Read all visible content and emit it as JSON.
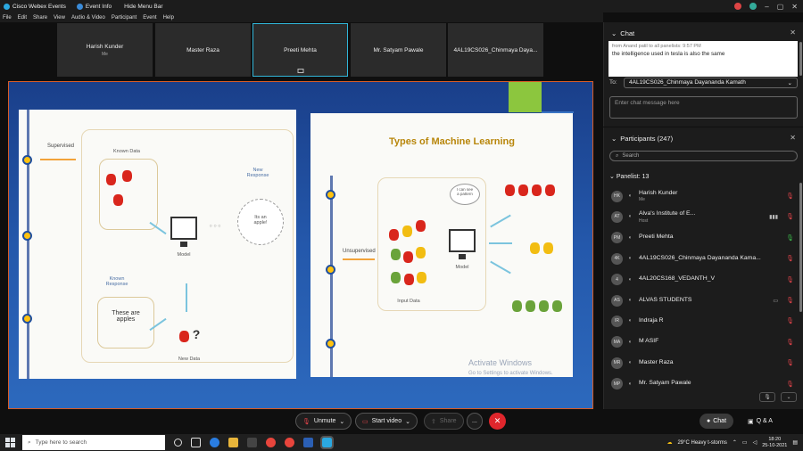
{
  "title_bar": {
    "app_name": "Cisco Webex Events",
    "event_info": "Event Info",
    "hide_menu": "Hide Menu Bar"
  },
  "menu": [
    "File",
    "Edit",
    "Share",
    "View",
    "Audio & Video",
    "Participant",
    "Event",
    "Help"
  ],
  "video_tiles": [
    {
      "name": "Harish Kunder",
      "sub": "Me"
    },
    {
      "name": "Master Raza"
    },
    {
      "name": "Preeti Mehta",
      "active": true
    },
    {
      "name": "Mr. Satyam Pawale"
    },
    {
      "name": "4AL19CS026_Chinmaya Daya..."
    }
  ],
  "slide_left": {
    "supervised_label": "Supervised",
    "known_data": "Known Data",
    "new_response": "New\nResponse",
    "cloud_text": "Its an\napple!",
    "model": "Model",
    "known_response": "Known\nResponse",
    "these_are": "These are\napples",
    "new_data": "New Data"
  },
  "slide_right": {
    "title": "Types of Machine Learning",
    "unsupervised_label": "Unsupervised",
    "speech": "I can see\na pattern",
    "input_data": "Input Data",
    "model": "Model"
  },
  "watermark": {
    "line1": "Activate Windows",
    "line2": "Go to Settings to activate Windows."
  },
  "controls": {
    "unmute": "Unmute",
    "start_video": "Start video",
    "share": "Share",
    "more": "...",
    "chat": "Chat",
    "qa": "Q & A"
  },
  "chat": {
    "header": "Chat",
    "message_from": "from Anand patil to all panelists:   9:57 PM",
    "message_text": "the intelligence used in tesla is also the same",
    "to_label": "To:",
    "to_value": "4AL19CS026_Chinmaya Dayananda Kamath",
    "input_placeholder": "Enter chat message here"
  },
  "participants": {
    "header": "Participants (247)",
    "search_placeholder": "Search",
    "panelist_header": "Panelist: 13",
    "list": [
      {
        "initials": "HK",
        "name": "Harish Kunder",
        "sub": "Me",
        "mic": "muted"
      },
      {
        "initials": "AT",
        "name": "Alva's Institute of E...",
        "sub": "Host",
        "mic": "muted",
        "extra": "▮▮▮"
      },
      {
        "initials": "PM",
        "name": "Preeti Mehta",
        "mic": "on"
      },
      {
        "initials": "4K",
        "name": "4AL19CS026_Chinmaya Dayananda Kama...",
        "mic": "muted"
      },
      {
        "initials": "4",
        "name": "4AL20CS168_VEDANTH_V",
        "mic": "muted"
      },
      {
        "initials": "AS",
        "name": "ALVAS STUDENTS",
        "mic": "muted",
        "extra": "▭"
      },
      {
        "initials": "IR",
        "name": "Indraja R",
        "mic": "muted"
      },
      {
        "initials": "MA",
        "name": "M ASIF",
        "mic": "muted"
      },
      {
        "initials": "MR",
        "name": "Master Raza",
        "mic": "muted"
      },
      {
        "initials": "MP",
        "name": "Mr. Satyam Pawale",
        "mic": "muted"
      }
    ]
  },
  "taskbar": {
    "search_placeholder": "Type here to search",
    "weather": "29°C  Heavy t-storms",
    "time": "18:20",
    "date": "25-10-2021"
  },
  "colors": {
    "accent": "#31b6d9",
    "end_call": "#e0262c",
    "stage_border": "#d85c27"
  }
}
